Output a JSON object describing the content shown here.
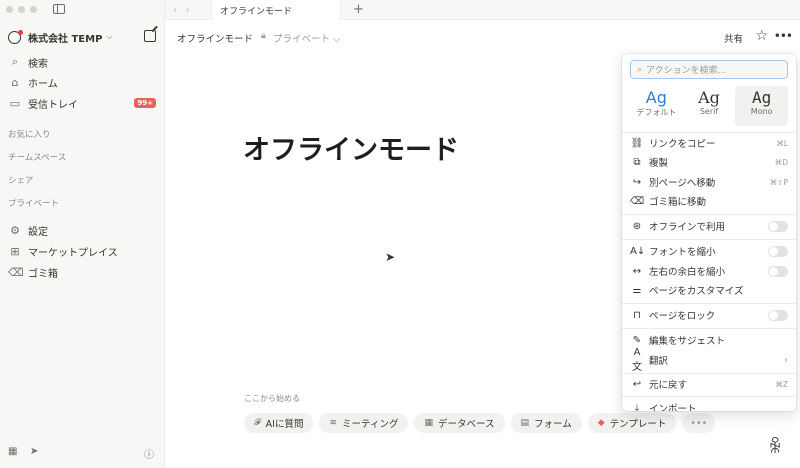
{
  "sidebar": {
    "workspace": "株式会社 TEMP",
    "nav": [
      {
        "icon": "search-icon",
        "glyph": "⌕",
        "label": "検索"
      },
      {
        "icon": "home-icon",
        "glyph": "⌂",
        "label": "ホーム"
      },
      {
        "icon": "inbox-icon",
        "glyph": "▭",
        "label": "受信トレイ",
        "badge": "99+"
      }
    ],
    "sections": [
      "お気に入り",
      "チームスペース",
      "シェア",
      "プライベート"
    ],
    "bottom_nav": [
      {
        "icon": "settings-icon",
        "glyph": "⚙",
        "label": "設定"
      },
      {
        "icon": "marketplace-icon",
        "glyph": "⊞",
        "label": "マーケットプレイス"
      },
      {
        "icon": "trash-icon",
        "glyph": "🗑",
        "label": "ゴミ箱"
      }
    ]
  },
  "tabbar": {
    "tab_title": "オフラインモード"
  },
  "header": {
    "breadcrumb_title": "オフラインモード",
    "breadcrumb_private": "プライベート",
    "share": "共有"
  },
  "page": {
    "title": "オフラインモード",
    "start_label": "ここから始める",
    "start_actions": [
      "AIに質問",
      "ミーティング",
      "データベース",
      "フォーム",
      "テンプレート"
    ]
  },
  "menu": {
    "search_placeholder": "アクションを検索...",
    "fonts": [
      {
        "sample": "Ag",
        "name": "デフォルト",
        "selected": false
      },
      {
        "sample": "Ag",
        "name": "Serif",
        "selected": false
      },
      {
        "sample": "Ag",
        "name": "Mono",
        "selected": true
      }
    ],
    "items": [
      {
        "label": "リンクをコピー",
        "shortcut": "⌘L"
      },
      {
        "label": "複製",
        "shortcut": "⌘D"
      },
      {
        "label": "別ページへ移動",
        "shortcut": "⌘⇧P"
      },
      {
        "label": "ゴミ箱に移動",
        "shortcut": ""
      },
      {
        "label": "オフラインで利用",
        "toggle": false
      },
      {
        "label": "フォントを縮小",
        "toggle": false
      },
      {
        "label": "左右の余白を縮小",
        "toggle": false
      },
      {
        "label": "ページをカスタマイズ"
      },
      {
        "label": "ページをロック",
        "toggle": false
      },
      {
        "label": "編集をサジェスト"
      },
      {
        "label": "翻訳"
      },
      {
        "label": "元に戻す",
        "shortcut": "⌘Z"
      },
      {
        "label": "インポート"
      }
    ]
  }
}
